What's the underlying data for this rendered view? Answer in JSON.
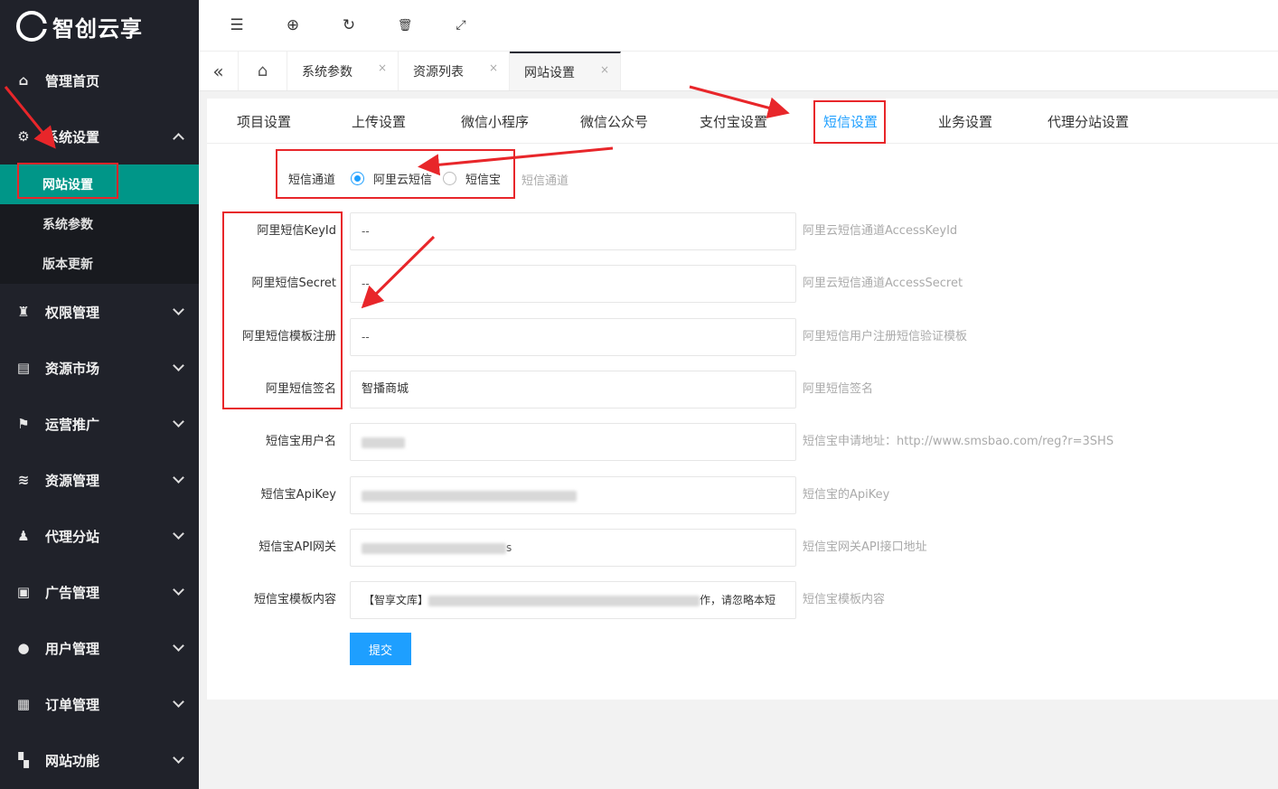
{
  "logo": {
    "text": "智创云享"
  },
  "sidebar": {
    "items": [
      {
        "label": "管理首页",
        "icon": "home-icon"
      },
      {
        "label": "系统设置",
        "icon": "gear-icon",
        "expanded": true,
        "children": [
          {
            "label": "网站设置",
            "active": true
          },
          {
            "label": "系统参数"
          },
          {
            "label": "版本更新"
          }
        ]
      },
      {
        "label": "权限管理",
        "icon": "user-lock-icon"
      },
      {
        "label": "资源市场",
        "icon": "store-icon"
      },
      {
        "label": "运营推广",
        "icon": "flag-icon"
      },
      {
        "label": "资源管理",
        "icon": "layers-icon"
      },
      {
        "label": "代理分站",
        "icon": "group-icon"
      },
      {
        "label": "广告管理",
        "icon": "ad-icon"
      },
      {
        "label": "用户管理",
        "icon": "user-icon"
      },
      {
        "label": "订单管理",
        "icon": "clipboard-icon"
      },
      {
        "label": "网站功能",
        "icon": "grid-icon"
      }
    ]
  },
  "topbar": {
    "icons": [
      "menu-indent-icon",
      "globe-icon",
      "refresh-icon",
      "trash-icon",
      "fullscreen-icon"
    ]
  },
  "tabs": {
    "items": [
      {
        "label": "系统参数"
      },
      {
        "label": "资源列表"
      },
      {
        "label": "网站设置",
        "active": true
      }
    ],
    "close_glyph": "×"
  },
  "settings_tabs": [
    "项目设置",
    "上传设置",
    "微信小程序",
    "微信公众号",
    "支付宝设置",
    "短信设置",
    "业务设置",
    "代理分站设置"
  ],
  "settings_tabs_active": "短信设置",
  "sms": {
    "channel_label": "短信通道",
    "options": [
      "阿里云短信",
      "短信宝"
    ],
    "selected": "阿里云短信",
    "channel_hint": "短信通道"
  },
  "fields": [
    {
      "label": "阿里短信KeyId",
      "value": "--",
      "hint": "阿里云短信通道AccessKeyId"
    },
    {
      "label": "阿里短信Secret",
      "value": "--",
      "hint": "阿里云短信通道AccessSecret"
    },
    {
      "label": "阿里短信模板注册",
      "value": "--",
      "hint": "阿里短信用户注册短信验证模板"
    },
    {
      "label": "阿里短信签名",
      "value": "智播商城",
      "hint": "阿里短信签名"
    },
    {
      "label": "短信宝用户名",
      "value": "",
      "hint": "短信宝申请地址：http://www.smsbao.com/reg?r=3SHS"
    },
    {
      "label": "短信宝ApiKey",
      "value": "",
      "hint": "短信宝的ApiKey"
    },
    {
      "label": "短信宝API网关",
      "value": "s",
      "hint": "短信宝网关API接口地址"
    },
    {
      "label": "短信宝模板内容",
      "value_prefix": "【智享文库】",
      "value_suffix": "作，请忽略本短",
      "hint": "短信宝模板内容"
    }
  ],
  "submit_label": "提交",
  "colors": {
    "sidebar_bg": "#20222a",
    "active_green": "#009688",
    "accent_blue": "#1e9fff",
    "annotation_red": "#e8262a"
  }
}
